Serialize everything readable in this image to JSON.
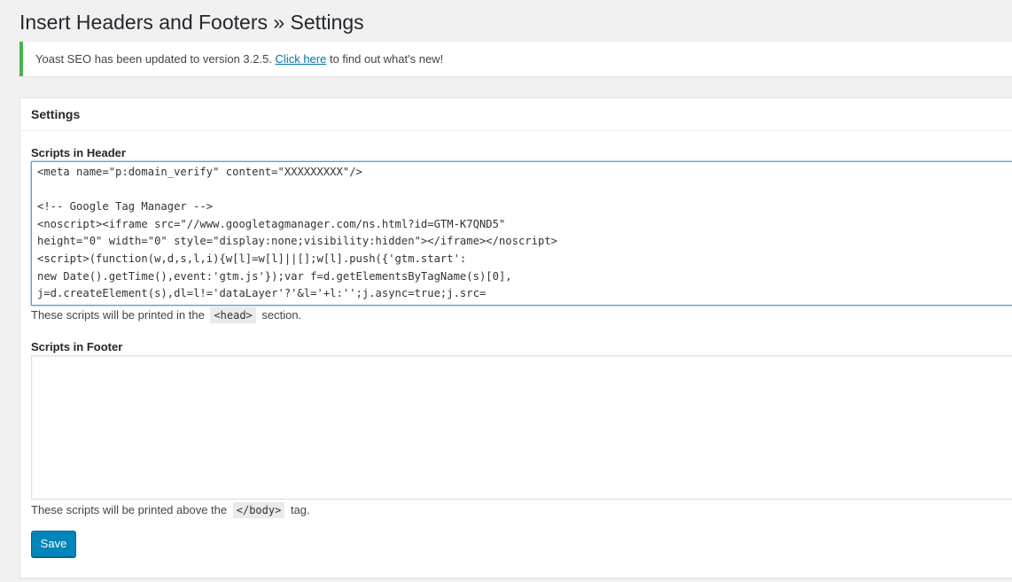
{
  "page_title": "Insert Headers and Footers » Settings",
  "notice": {
    "text_before": "Yoast SEO has been updated to version 3.2.5. ",
    "link_text": "Click here",
    "text_after": " to find out what's new!",
    "accent_color": "#46b450"
  },
  "settings_box": {
    "title": "Settings",
    "header_scripts": {
      "label": "Scripts in Header",
      "value": "<meta name=\"p:domain_verify\" content=\"XXXXXXXXX\"/>\n\n<!-- Google Tag Manager -->\n<noscript><iframe src=\"//www.googletagmanager.com/ns.html?id=GTM-K7QND5\"\nheight=\"0\" width=\"0\" style=\"display:none;visibility:hidden\"></iframe></noscript>\n<script>(function(w,d,s,l,i){w[l]=w[l]||[];w[l].push({'gtm.start':\nnew Date().getTime(),event:'gtm.js'});var f=d.getElementsByTagName(s)[0],\nj=d.createElement(s),dl=l!='dataLayer'?'&l='+l:'';j.async=true;j.src=",
      "description_before": "These scripts will be printed in the",
      "description_code": "<head>",
      "description_after": "section."
    },
    "footer_scripts": {
      "label": "Scripts in Footer",
      "value": "",
      "description_before": "These scripts will be printed above the",
      "description_code": "</body>",
      "description_after": "tag."
    },
    "save_label": "Save",
    "button_color": "#0085ba"
  }
}
